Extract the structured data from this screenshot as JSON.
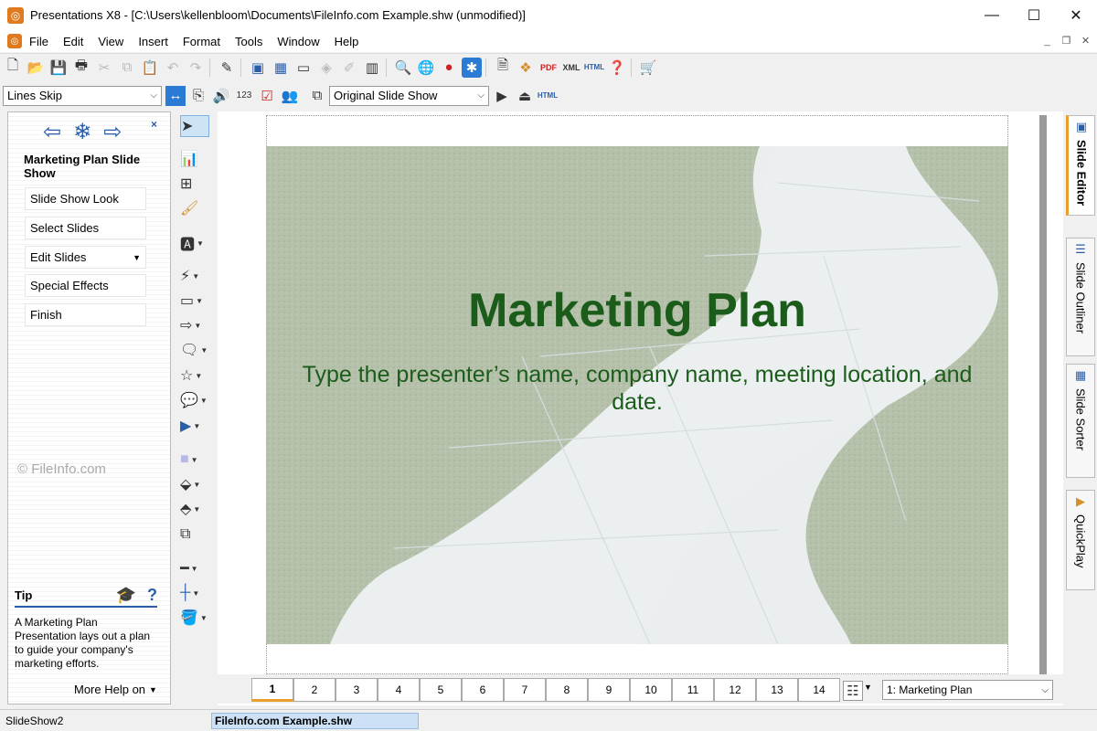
{
  "window": {
    "title": "Presentations X8 - [C:\\Users\\kellenbloom\\Documents\\FileInfo.com Example.shw (unmodified)]",
    "app_icon": "presentations-app-icon",
    "controls": [
      "minimize",
      "maximize",
      "close"
    ]
  },
  "menu": [
    "File",
    "Edit",
    "View",
    "Insert",
    "Format",
    "Tools",
    "Window",
    "Help"
  ],
  "toolbar2": {
    "line_style": "Lines Skip",
    "slideshow": "Original Slide Show"
  },
  "left_panel": {
    "title": "Marketing Plan Slide Show",
    "tasks": [
      "Slide Show Look",
      "Select Slides",
      "Edit Slides",
      "Special Effects",
      "Finish"
    ],
    "watermark": "© FileInfo.com",
    "tip_label": "Tip",
    "tip_text": "A Marketing Plan Presentation lays out a plan to guide your company's marketing efforts.",
    "more_help": "More Help on"
  },
  "slide": {
    "title": "Marketing Plan",
    "subtitle": "Type the presenter’s name, company name, meeting location, and date."
  },
  "page_tabs": [
    "1",
    "2",
    "3",
    "4",
    "5",
    "6",
    "7",
    "8",
    "9",
    "10",
    "11",
    "12",
    "13",
    "14"
  ],
  "active_page": "1",
  "slide_select": "1: Marketing Plan",
  "right_tabs": [
    "Slide Editor",
    "Slide Outliner",
    "Slide Sorter",
    "QuickPlay"
  ],
  "status": {
    "left": "SlideShow2",
    "file": "FileInfo.com Example.shw"
  },
  "colors": {
    "slide_text": "#1b5c1b",
    "accent_tab": "#e8a02a",
    "link_blue": "#2b5ea8"
  }
}
